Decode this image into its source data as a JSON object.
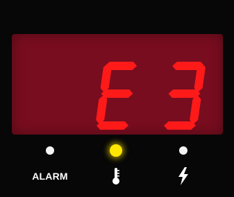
{
  "display": {
    "readout": "E3",
    "segment_color": "#ff1a1a",
    "background_color": "#780d1f"
  },
  "indicators": [
    {
      "label": "ALARM",
      "icon": null,
      "lit": false
    },
    {
      "label": "",
      "icon": "thermometer-icon",
      "lit": true,
      "lit_color": "#ffe600"
    },
    {
      "label": "",
      "icon": "lightning-bolt-icon",
      "lit": false
    }
  ]
}
